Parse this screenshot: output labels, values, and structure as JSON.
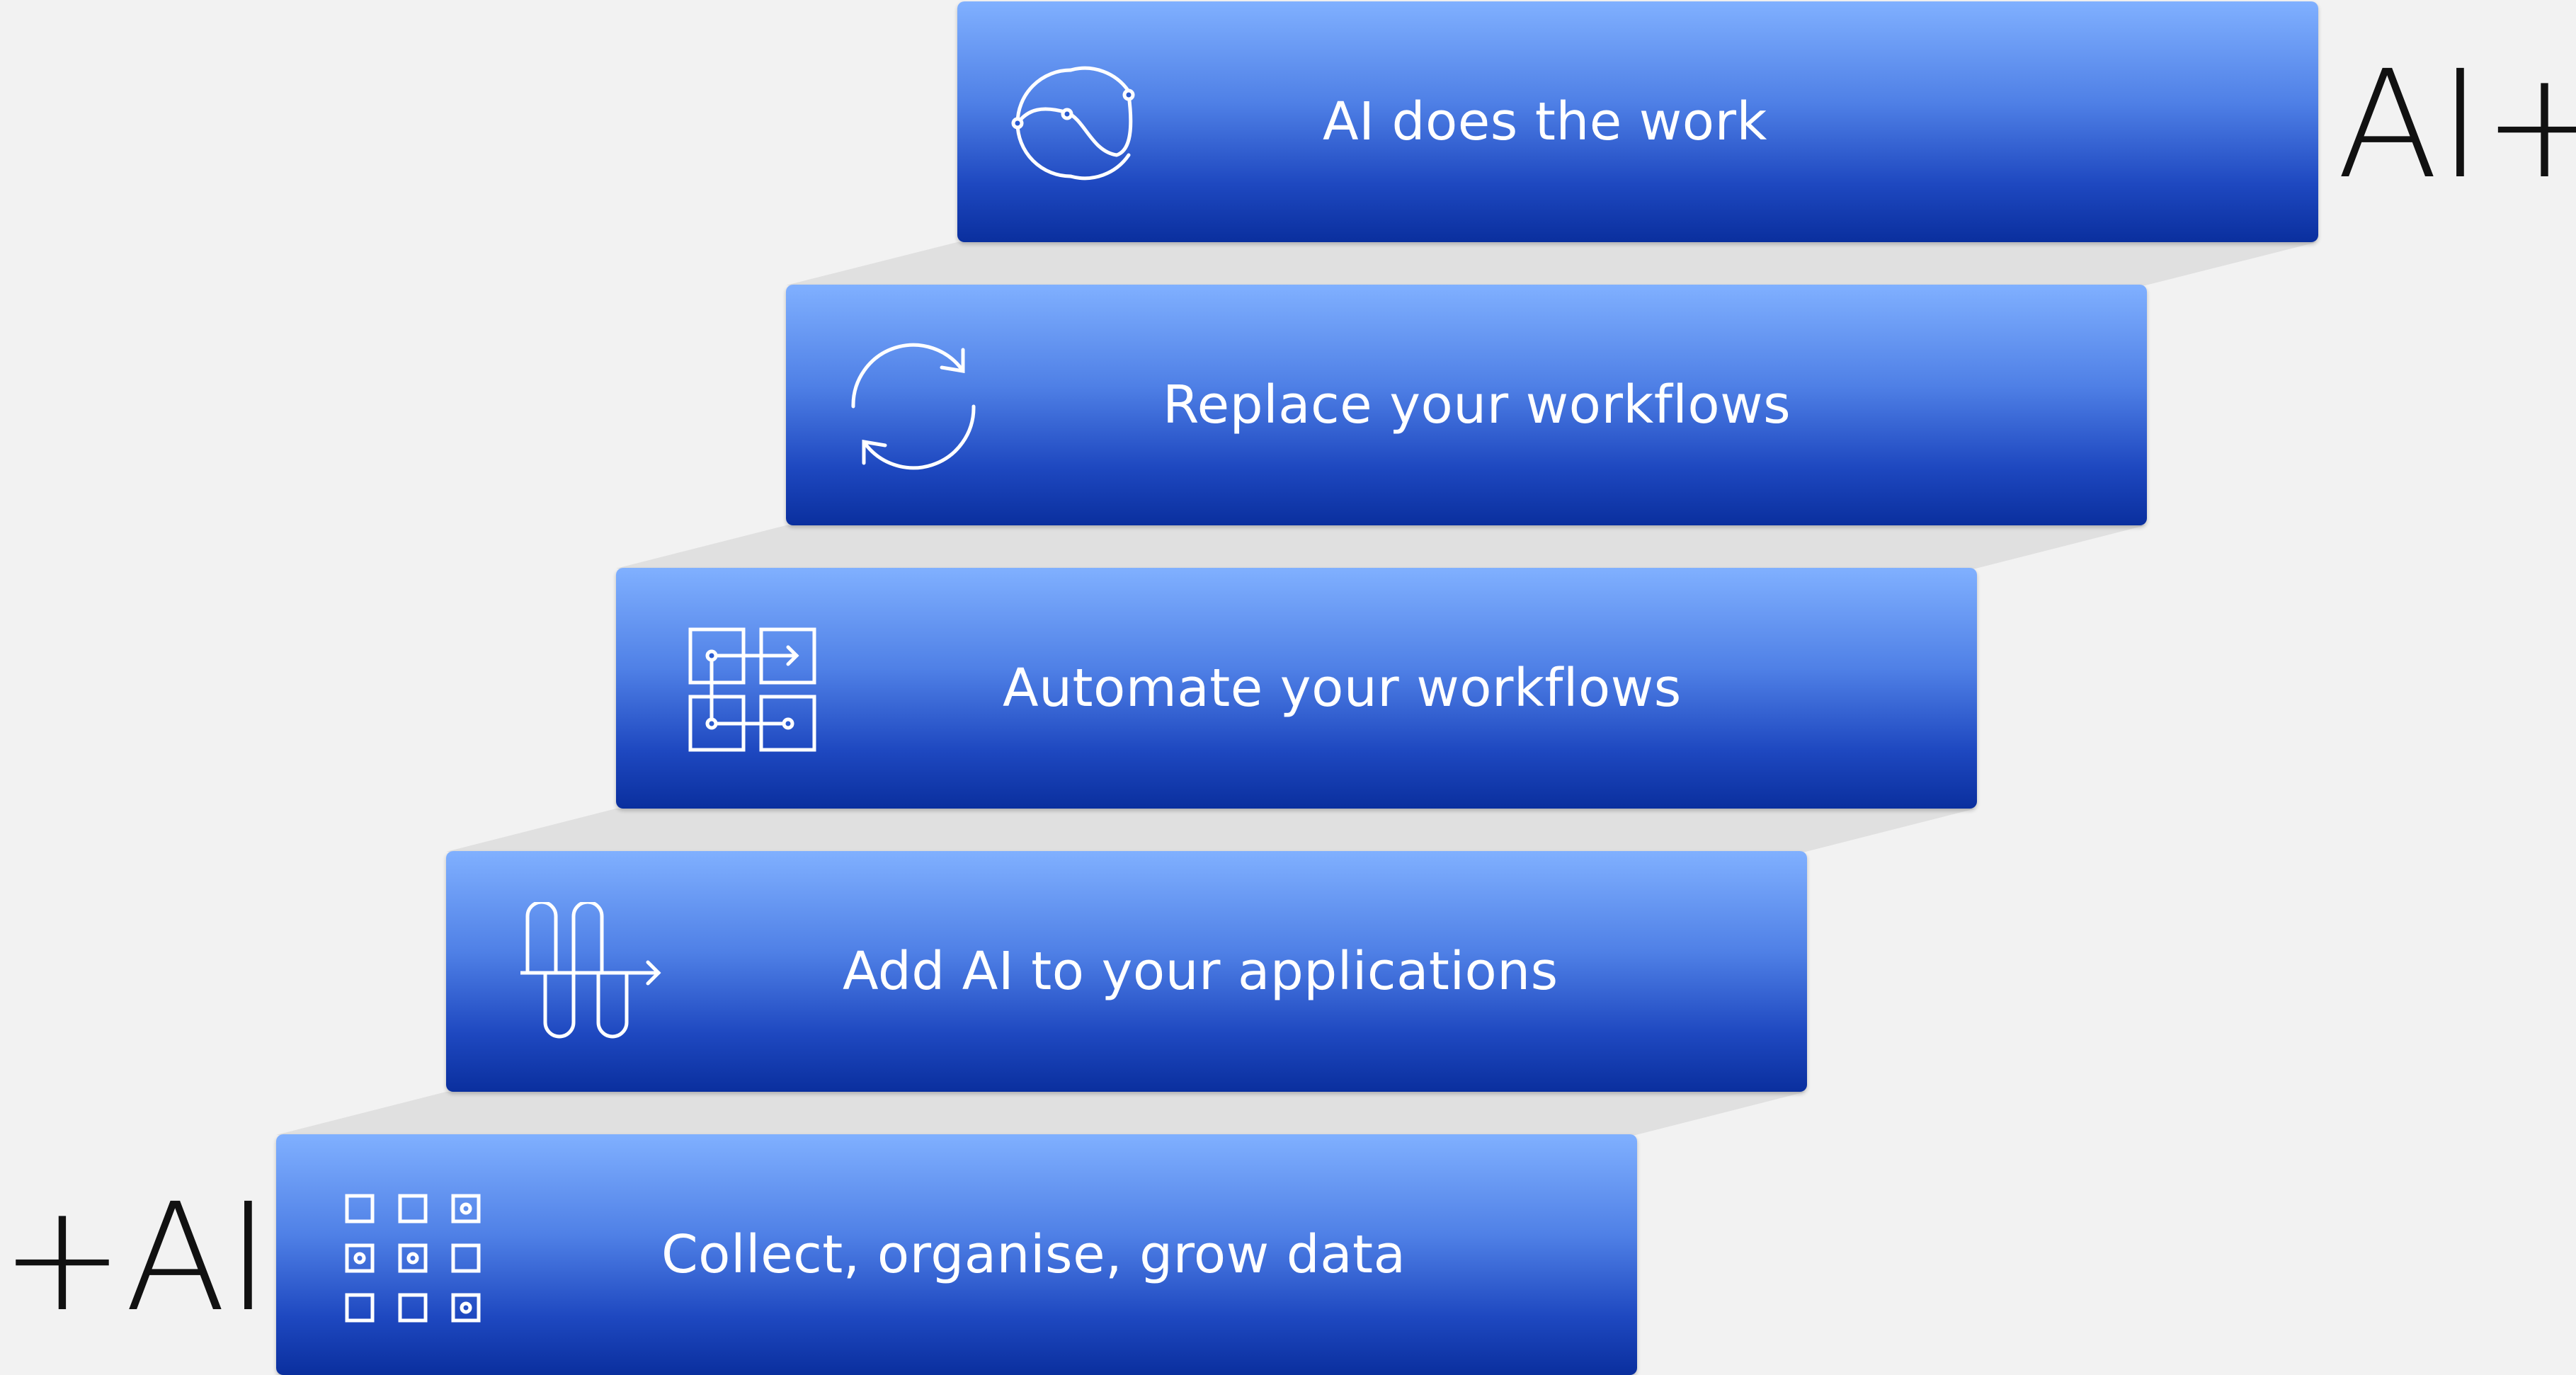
{
  "steps": [
    {
      "label": "AI does the work",
      "icon": "ai-cycle-icon"
    },
    {
      "label": "Replace your workflows",
      "icon": "refresh-arrows-icon"
    },
    {
      "label": "Automate your workflows",
      "icon": "workflow-grid-icon"
    },
    {
      "label": "Add AI to your applications",
      "icon": "app-integration-icon"
    },
    {
      "label": "Collect, organise, grow data",
      "icon": "data-grid-icon"
    }
  ],
  "tags": {
    "top_right": "AI+",
    "bottom_left": "+AI"
  },
  "colors": {
    "background": "#f2f2f2",
    "step_top": "#80b0ff",
    "step_bottom": "#0a2f9e",
    "step_text": "#ffffff",
    "riser": "#e0e0e0",
    "tag_text": "#111111"
  }
}
